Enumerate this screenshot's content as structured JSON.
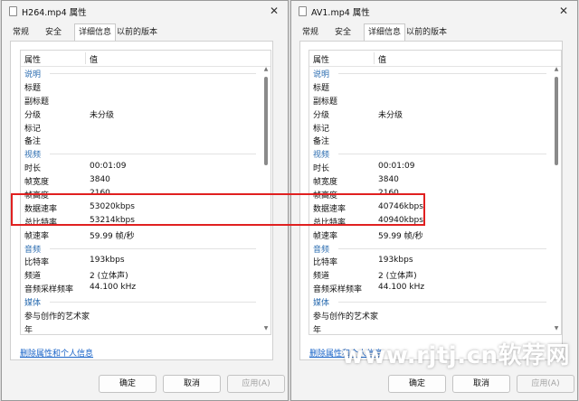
{
  "windows": [
    {
      "title": "H264.mp4 属性",
      "tabs": [
        "常规",
        "安全",
        "详细信息",
        "以前的版本"
      ],
      "active_tab": 2,
      "header": {
        "prop": "属性",
        "value": "值"
      },
      "rows": [
        {
          "group": "说明"
        },
        {
          "k": "标题",
          "v": ""
        },
        {
          "k": "副标题",
          "v": ""
        },
        {
          "k": "分级",
          "v": "未分级"
        },
        {
          "k": "标记",
          "v": ""
        },
        {
          "k": "备注",
          "v": ""
        },
        {
          "group": "视频"
        },
        {
          "k": "时长",
          "v": "00:01:09"
        },
        {
          "k": "帧宽度",
          "v": "3840"
        },
        {
          "k": "帧高度",
          "v": "2160"
        },
        {
          "k": "数据速率",
          "v": "53020kbps"
        },
        {
          "k": "总比特率",
          "v": "53214kbps"
        },
        {
          "k": "帧速率",
          "v": "59.99 帧/秒"
        },
        {
          "group": "音频"
        },
        {
          "k": "比特率",
          "v": "193kbps"
        },
        {
          "k": "频道",
          "v": "2 (立体声)"
        },
        {
          "k": "音频采样频率",
          "v": "44.100 kHz"
        },
        {
          "group": "媒体"
        },
        {
          "k": "参与创作的艺术家",
          "v": ""
        },
        {
          "k": "年",
          "v": ""
        }
      ],
      "remove_link": "删除属性和个人信息",
      "buttons": {
        "ok": "确定",
        "cancel": "取消",
        "apply": "应用(A)"
      }
    },
    {
      "title": "AV1.mp4 属性",
      "tabs": [
        "常规",
        "安全",
        "详细信息",
        "以前的版本"
      ],
      "active_tab": 2,
      "header": {
        "prop": "属性",
        "value": "值"
      },
      "rows": [
        {
          "group": "说明"
        },
        {
          "k": "标题",
          "v": ""
        },
        {
          "k": "副标题",
          "v": ""
        },
        {
          "k": "分级",
          "v": "未分级"
        },
        {
          "k": "标记",
          "v": ""
        },
        {
          "k": "备注",
          "v": ""
        },
        {
          "group": "视频"
        },
        {
          "k": "时长",
          "v": "00:01:09"
        },
        {
          "k": "帧宽度",
          "v": "3840"
        },
        {
          "k": "帧高度",
          "v": "2160"
        },
        {
          "k": "数据速率",
          "v": "40746kbps"
        },
        {
          "k": "总比特率",
          "v": "40940kbps"
        },
        {
          "k": "帧速率",
          "v": "59.99 帧/秒"
        },
        {
          "group": "音频"
        },
        {
          "k": "比特率",
          "v": "193kbps"
        },
        {
          "k": "频道",
          "v": "2 (立体声)"
        },
        {
          "k": "音频采样频率",
          "v": "44.100 kHz"
        },
        {
          "group": "媒体"
        },
        {
          "k": "参与创作的艺术家",
          "v": ""
        },
        {
          "k": "年",
          "v": ""
        }
      ],
      "remove_link": "删除属性和个人信息",
      "buttons": {
        "ok": "确定",
        "cancel": "取消",
        "apply": "应用(A)"
      }
    }
  ],
  "close_glyph": "✕",
  "scroll_up_glyph": "▲",
  "scroll_down_glyph": "▼",
  "watermark": "www.rjtj.cn软荐网",
  "colors": {
    "group_label": "#2b6cb0",
    "highlight_box": "#e02020",
    "link": "#1a64c8"
  }
}
